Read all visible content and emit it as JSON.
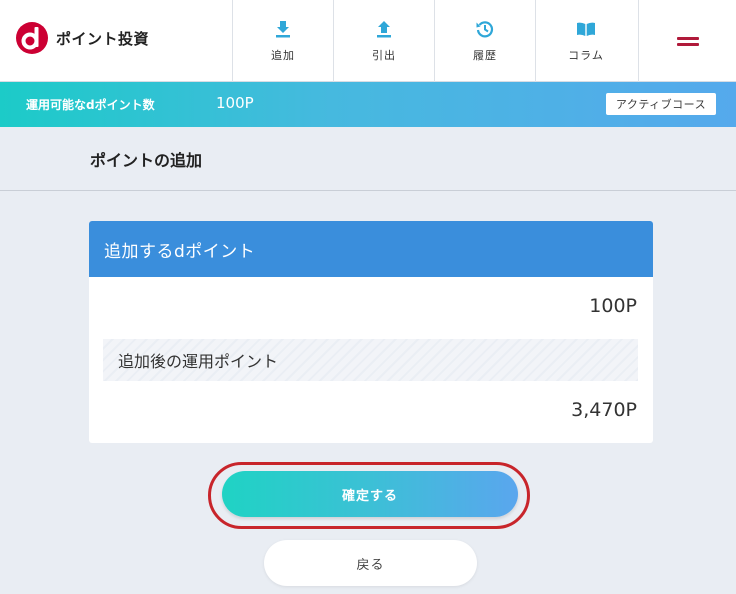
{
  "header": {
    "logo_text": "ポイント投資",
    "nav": [
      {
        "label": "追加",
        "icon": "download-icon"
      },
      {
        "label": "引出",
        "icon": "upload-icon"
      },
      {
        "label": "履歴",
        "icon": "history-icon"
      },
      {
        "label": "コラム",
        "icon": "book-icon"
      }
    ],
    "menu_icon": "hamburger-menu-icon"
  },
  "points_bar": {
    "label": "運用可能なdポイント数",
    "value": "100P",
    "badge": "アクティブコース"
  },
  "section": {
    "title": "ポイントの追加"
  },
  "card": {
    "header": "追加するdポイント",
    "add_amount": "100P",
    "after_label": "追加後の運用ポイント",
    "after_amount": "3,470P"
  },
  "buttons": {
    "confirm": "確定する",
    "back": "戻る"
  },
  "colors": {
    "brand_red": "#cc0033",
    "nav_icon": "#2fa7d8",
    "card_header": "#3a8edc",
    "highlight_ring": "#c8252b"
  }
}
